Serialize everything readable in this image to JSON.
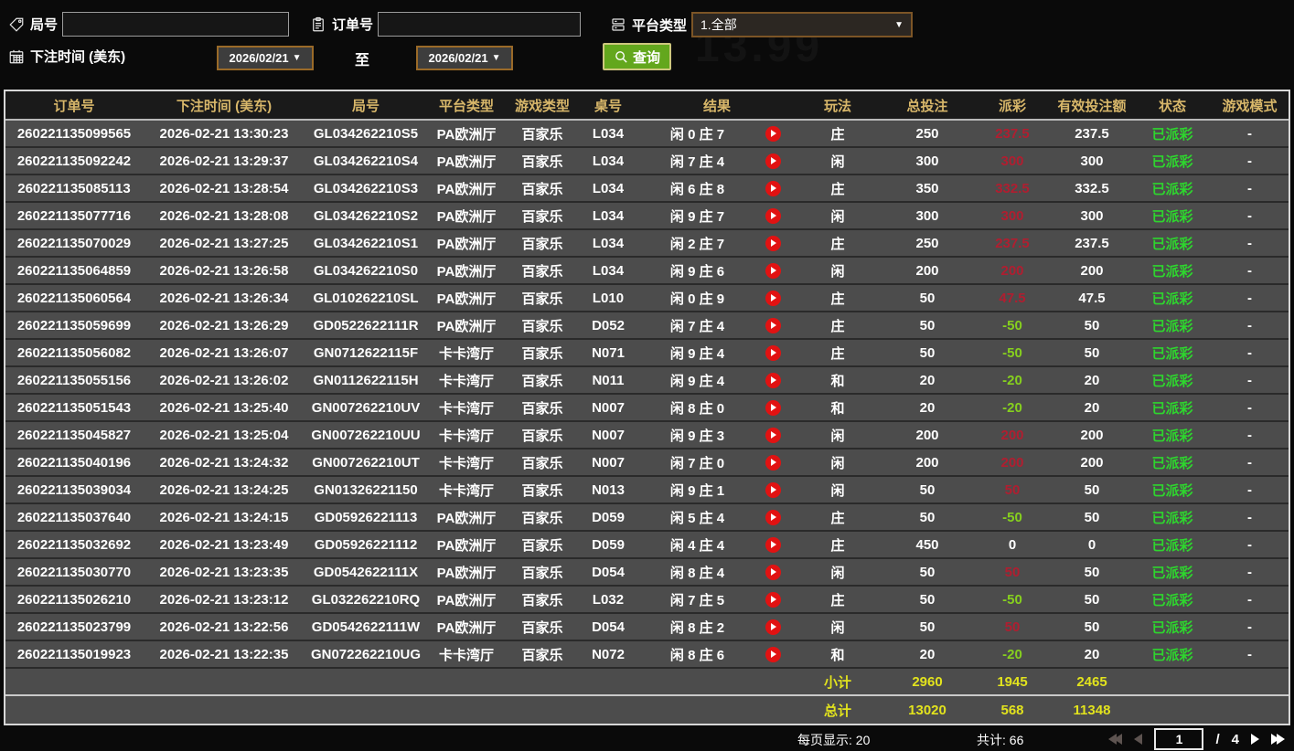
{
  "filters": {
    "round_label": "局号",
    "round_value": "",
    "order_label": "订单号",
    "order_value": "",
    "platform_label": "平台类型",
    "platform_value": "1.全部",
    "bet_time_label": "下注时间 (美东)",
    "date_from": "2026/02/21",
    "to_label": "至",
    "date_to": "2026/02/21",
    "query_label": "查询",
    "caret": "▼",
    "watermark": "13.99"
  },
  "table": {
    "columns": [
      "订单号",
      "下注时间 (美东)",
      "局号",
      "平台类型",
      "游戏类型",
      "桌号",
      "结果",
      "玩法",
      "总投注",
      "派彩",
      "有效投注额",
      "状态",
      "游戏模式"
    ],
    "rows": [
      {
        "order": "260221135099565",
        "time": "2026-02-21 13:30:23",
        "round": "GL034262210S5",
        "platform": "PA欧洲厅",
        "game": "百家乐",
        "table": "L034",
        "result": "闲 0 庄 7",
        "play": "庄",
        "bet": "250",
        "payout": "237.5",
        "payout_class": "pos",
        "valid": "237.5",
        "status": "已派彩",
        "mode": "-"
      },
      {
        "order": "260221135092242",
        "time": "2026-02-21 13:29:37",
        "round": "GL034262210S4",
        "platform": "PA欧洲厅",
        "game": "百家乐",
        "table": "L034",
        "result": "闲 7 庄 4",
        "play": "闲",
        "bet": "300",
        "payout": "300",
        "payout_class": "pos",
        "valid": "300",
        "status": "已派彩",
        "mode": "-"
      },
      {
        "order": "260221135085113",
        "time": "2026-02-21 13:28:54",
        "round": "GL034262210S3",
        "platform": "PA欧洲厅",
        "game": "百家乐",
        "table": "L034",
        "result": "闲 6 庄 8",
        "play": "庄",
        "bet": "350",
        "payout": "332.5",
        "payout_class": "pos",
        "valid": "332.5",
        "status": "已派彩",
        "mode": "-"
      },
      {
        "order": "260221135077716",
        "time": "2026-02-21 13:28:08",
        "round": "GL034262210S2",
        "platform": "PA欧洲厅",
        "game": "百家乐",
        "table": "L034",
        "result": "闲 9 庄 7",
        "play": "闲",
        "bet": "300",
        "payout": "300",
        "payout_class": "pos",
        "valid": "300",
        "status": "已派彩",
        "mode": "-"
      },
      {
        "order": "260221135070029",
        "time": "2026-02-21 13:27:25",
        "round": "GL034262210S1",
        "platform": "PA欧洲厅",
        "game": "百家乐",
        "table": "L034",
        "result": "闲 2 庄 7",
        "play": "庄",
        "bet": "250",
        "payout": "237.5",
        "payout_class": "pos",
        "valid": "237.5",
        "status": "已派彩",
        "mode": "-"
      },
      {
        "order": "260221135064859",
        "time": "2026-02-21 13:26:58",
        "round": "GL034262210S0",
        "platform": "PA欧洲厅",
        "game": "百家乐",
        "table": "L034",
        "result": "闲 9 庄 6",
        "play": "闲",
        "bet": "200",
        "payout": "200",
        "payout_class": "pos",
        "valid": "200",
        "status": "已派彩",
        "mode": "-"
      },
      {
        "order": "260221135060564",
        "time": "2026-02-21 13:26:34",
        "round": "GL010262210SL",
        "platform": "PA欧洲厅",
        "game": "百家乐",
        "table": "L010",
        "result": "闲 0 庄 9",
        "play": "庄",
        "bet": "50",
        "payout": "47.5",
        "payout_class": "pos",
        "valid": "47.5",
        "status": "已派彩",
        "mode": "-"
      },
      {
        "order": "260221135059699",
        "time": "2026-02-21 13:26:29",
        "round": "GD0522622111R",
        "platform": "PA欧洲厅",
        "game": "百家乐",
        "table": "D052",
        "result": "闲 7 庄 4",
        "play": "庄",
        "bet": "50",
        "payout": "-50",
        "payout_class": "neg",
        "valid": "50",
        "status": "已派彩",
        "mode": "-"
      },
      {
        "order": "260221135056082",
        "time": "2026-02-21 13:26:07",
        "round": "GN0712622115F",
        "platform": "卡卡湾厅",
        "game": "百家乐",
        "table": "N071",
        "result": "闲 9 庄 4",
        "play": "庄",
        "bet": "50",
        "payout": "-50",
        "payout_class": "neg",
        "valid": "50",
        "status": "已派彩",
        "mode": "-"
      },
      {
        "order": "260221135055156",
        "time": "2026-02-21 13:26:02",
        "round": "GN0112622115H",
        "platform": "卡卡湾厅",
        "game": "百家乐",
        "table": "N011",
        "result": "闲 9 庄 4",
        "play": "和",
        "bet": "20",
        "payout": "-20",
        "payout_class": "neg",
        "valid": "20",
        "status": "已派彩",
        "mode": "-"
      },
      {
        "order": "260221135051543",
        "time": "2026-02-21 13:25:40",
        "round": "GN007262210UV",
        "platform": "卡卡湾厅",
        "game": "百家乐",
        "table": "N007",
        "result": "闲 8 庄 0",
        "play": "和",
        "bet": "20",
        "payout": "-20",
        "payout_class": "neg",
        "valid": "20",
        "status": "已派彩",
        "mode": "-"
      },
      {
        "order": "260221135045827",
        "time": "2026-02-21 13:25:04",
        "round": "GN007262210UU",
        "platform": "卡卡湾厅",
        "game": "百家乐",
        "table": "N007",
        "result": "闲 9 庄 3",
        "play": "闲",
        "bet": "200",
        "payout": "200",
        "payout_class": "pos",
        "valid": "200",
        "status": "已派彩",
        "mode": "-"
      },
      {
        "order": "260221135040196",
        "time": "2026-02-21 13:24:32",
        "round": "GN007262210UT",
        "platform": "卡卡湾厅",
        "game": "百家乐",
        "table": "N007",
        "result": "闲 7 庄 0",
        "play": "闲",
        "bet": "200",
        "payout": "200",
        "payout_class": "pos",
        "valid": "200",
        "status": "已派彩",
        "mode": "-"
      },
      {
        "order": "260221135039034",
        "time": "2026-02-21 13:24:25",
        "round": "GN01326221150",
        "platform": "卡卡湾厅",
        "game": "百家乐",
        "table": "N013",
        "result": "闲 9 庄 1",
        "play": "闲",
        "bet": "50",
        "payout": "50",
        "payout_class": "pos",
        "valid": "50",
        "status": "已派彩",
        "mode": "-"
      },
      {
        "order": "260221135037640",
        "time": "2026-02-21 13:24:15",
        "round": "GD05926221113",
        "platform": "PA欧洲厅",
        "game": "百家乐",
        "table": "D059",
        "result": "闲 5 庄 4",
        "play": "庄",
        "bet": "50",
        "payout": "-50",
        "payout_class": "neg",
        "valid": "50",
        "status": "已派彩",
        "mode": "-"
      },
      {
        "order": "260221135032692",
        "time": "2026-02-21 13:23:49",
        "round": "GD05926221112",
        "platform": "PA欧洲厅",
        "game": "百家乐",
        "table": "D059",
        "result": "闲 4 庄 4",
        "play": "庄",
        "bet": "450",
        "payout": "0",
        "payout_class": "zero",
        "valid": "0",
        "status": "已派彩",
        "mode": "-"
      },
      {
        "order": "260221135030770",
        "time": "2026-02-21 13:23:35",
        "round": "GD0542622111X",
        "platform": "PA欧洲厅",
        "game": "百家乐",
        "table": "D054",
        "result": "闲 8 庄 4",
        "play": "闲",
        "bet": "50",
        "payout": "50",
        "payout_class": "pos",
        "valid": "50",
        "status": "已派彩",
        "mode": "-"
      },
      {
        "order": "260221135026210",
        "time": "2026-02-21 13:23:12",
        "round": "GL032262210RQ",
        "platform": "PA欧洲厅",
        "game": "百家乐",
        "table": "L032",
        "result": "闲 7 庄 5",
        "play": "庄",
        "bet": "50",
        "payout": "-50",
        "payout_class": "neg",
        "valid": "50",
        "status": "已派彩",
        "mode": "-"
      },
      {
        "order": "260221135023799",
        "time": "2026-02-21 13:22:56",
        "round": "GD0542622111W",
        "platform": "PA欧洲厅",
        "game": "百家乐",
        "table": "D054",
        "result": "闲 8 庄 2",
        "play": "闲",
        "bet": "50",
        "payout": "50",
        "payout_class": "pos",
        "valid": "50",
        "status": "已派彩",
        "mode": "-"
      },
      {
        "order": "260221135019923",
        "time": "2026-02-21 13:22:35",
        "round": "GN072262210UG",
        "platform": "卡卡湾厅",
        "game": "百家乐",
        "table": "N072",
        "result": "闲 8 庄 6",
        "play": "和",
        "bet": "20",
        "payout": "-20",
        "payout_class": "neg",
        "valid": "20",
        "status": "已派彩",
        "mode": "-"
      }
    ],
    "subtotal": {
      "label": "小计",
      "bet": "2960",
      "payout": "1945",
      "valid": "2465"
    },
    "total": {
      "label": "总计",
      "bet": "13020",
      "payout": "568",
      "valid": "11348"
    }
  },
  "footer": {
    "per_page": "每页显示: 20",
    "total_count": "共计: 66",
    "page": "1",
    "separator": "/",
    "total_pages": "4"
  },
  "colors": {
    "header_text": "#d8b76a",
    "row_bg": "#4c4c4c",
    "payout_positive": "#b01e30",
    "payout_negative": "#86d01e",
    "status_green": "#2ed52e",
    "sum_yellow": "#e2e31d",
    "query_green": "#63a71d",
    "date_border": "#9a6a28",
    "play_red": "#e11212"
  }
}
